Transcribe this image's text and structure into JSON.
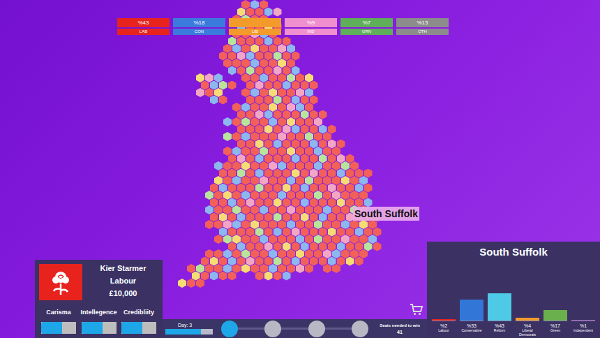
{
  "party_bar": [
    {
      "value": "%43",
      "label": "LAB",
      "color": "#e8231e"
    },
    {
      "value": "%18",
      "label": "CON",
      "color": "#3b7bde"
    },
    {
      "label": "LIB",
      "color": "#f39b2a"
    },
    {
      "value": "%9",
      "label": "IND",
      "color": "#f08fcf"
    },
    {
      "value": "%7",
      "label": "GRN",
      "color": "#5fae5a"
    },
    {
      "value": "%13",
      "label": "OTH",
      "color": "#8c8c8c"
    }
  ],
  "map": {
    "palette": {
      "L": "#f2605a",
      "C": "#8cb8ef",
      "Y": "#f7dc74",
      "I": "#f3a6c4",
      "G": "#b9e59b"
    },
    "rows": [
      "       LCL",
      "      YLLCI",
      "      LGLL",
      "      CLLYL",
      "      LLICL",
      "     GLLLCLL",
      "     LCLYLLIC",
      "    LLICLLGLL",
      "     LLLCLLYL",
      "     CLGLLILC",
      "  YIC  LLCLLGLY",
      "  LCGL LILLCLLL",
      "  ILY  LCLYLLIC",
      "   CL  LLLGLCLL",
      "      LCLLYLICL",
      "      LLICLLLGLL",
      "     CLGLLCLYLLI",
      "      LLLYLICLLCL",
      "     GLCLLLILLGLL",
      "      LLYLCLLLCLIL",
      "     LCLLGLLYLLCLL",
      "     LILCLLLCLLGLIL",
      "    CLLYLLICLLLCLLGL",
      "    LLGLCLLLYLILLCLLL",
      "    YLCLLILLCLGLLLYLC",
      "   LCLLLGLLYLCLLILLCL",
      "   GLYLCLLLCLLLGLILLL",
      "   LLCLILLYLLCLLLYLLC",
      "   CLLGLLCLLILLLCLLGL",
      "   LYLCLLLGLLYLCLLILLL",
      "   LLICLYLLLCLLGLLCLYL",
      "    CLLLGLCLILLLYLLCLL",
      "    LGYLLCLLLCLGLLILLC",
      "     LCLLILYLCLLLCLLGL",
      "   LLCLGLLCLLYLLICLLL",
      "  LYLCLILLGLCLLLCLYL",
      " LGLLCLYLLCLLIL LL",
      " YLCLL  LYLC",
      "YLL"
    ]
  },
  "tooltip": {
    "text": "South Suffolk"
  },
  "player": {
    "name": "Kier Starmer",
    "party": "Labour",
    "money": "£10,000",
    "stats": [
      {
        "label": "Carisma",
        "level": 0.6
      },
      {
        "label": "Intellegence",
        "level": 0.6
      },
      {
        "label": "Credibliity",
        "level": 0.6
      }
    ]
  },
  "timeline": {
    "day": "Day: 3",
    "level": 0.75,
    "steps": [
      {
        "selected": true
      },
      {
        "selected": false
      },
      {
        "selected": false
      },
      {
        "selected": false
      }
    ]
  },
  "seats": {
    "label": "Seats needed to win",
    "value": "41"
  },
  "constituency": {
    "title": "South Suffolk",
    "chart": {
      "values": [
        2,
        33,
        43,
        4,
        17,
        1
      ],
      "bars": [
        {
          "value": "%2",
          "label": "Labour",
          "color": "#e8231e"
        },
        {
          "value": "%33",
          "label": "Conservative",
          "color": "#3277d8"
        },
        {
          "value": "%43",
          "label": "Reform",
          "color": "#4ec9e6"
        },
        {
          "value": "%4",
          "label": "Liberal Democrats",
          "color": "#f39b2a"
        },
        {
          "value": "%17",
          "label": "Green",
          "color": "#6ab04c"
        },
        {
          "value": "%1",
          "label": "Independent",
          "color": "#9b59b6"
        }
      ]
    }
  }
}
